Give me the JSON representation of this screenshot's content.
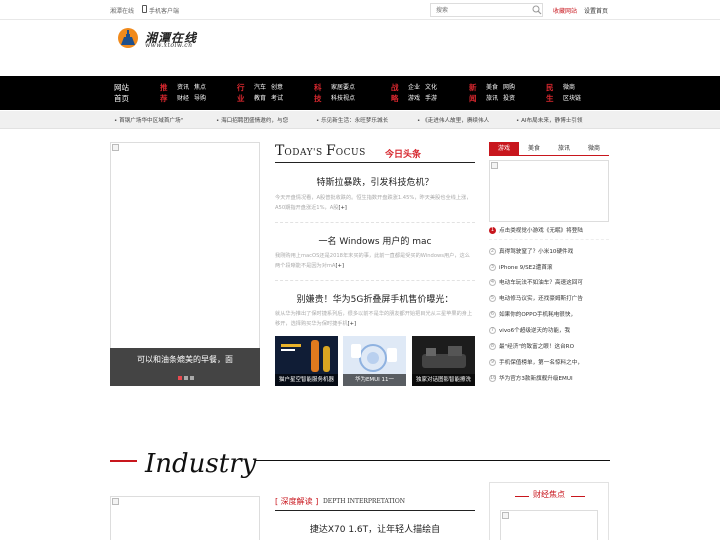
{
  "topbar": {
    "site_name": "湘潭在线",
    "mobile_client": "手机客户端",
    "search_placeholder": "搜索",
    "favorite": "收藏网站",
    "set_home": "设置首页"
  },
  "logo": {
    "title": "湘潭在线",
    "url": "www.xtolw.cn"
  },
  "nav": {
    "home": "网站首页",
    "groups": [
      {
        "cat": "推荐",
        "links": [
          "资讯",
          "焦点",
          "财经",
          "导购"
        ]
      },
      {
        "cat": "行业",
        "links": [
          "汽车",
          "创意",
          "教育",
          "考试"
        ]
      },
      {
        "cat": "科技",
        "links": [
          "家居要点",
          "科技视点"
        ]
      },
      {
        "cat": "战略",
        "links": [
          "企业",
          "文化",
          "游戏",
          "手游"
        ]
      },
      {
        "cat": "新闻",
        "links": [
          "美食",
          "网购",
          "旅讯",
          "投资"
        ]
      },
      {
        "cat": "民生",
        "links": [
          "微商",
          "区块链"
        ]
      }
    ]
  },
  "ticker": [
    "首钢广场华中区域首广场\"",
    "海口招聘团盛情邀约，与您",
    "乐见新生活：永旺梦乐城长",
    "《走进伟人故里，赓续伟人",
    "AI布局未来，静博士引领"
  ],
  "slideshow": {
    "caption": "可以和油条媲美的早餐，面",
    "dots": [
      {
        "active": true
      },
      {
        "active": false
      },
      {
        "active": false
      }
    ]
  },
  "focus": {
    "title_t": "T",
    "title_rest": "ODAY'S ",
    "title_f": "F",
    "title_rest2": "OCUS",
    "title_cn": "今日头条",
    "articles": [
      {
        "title": "特斯拉暴跌，引发科技危机？",
        "body": "今天开盘情况看，A股普批收跌的。恒生指数开盘跌涨1.45%，昨天美股也全线上涨，A50期指开盘涨近1%，A股",
        "more": "[+]"
      },
      {
        "title": "一名 Windows 用户的 mac",
        "body": "我刚购用上macOS还是2018年末买的事，此前一直都是受买的Windows用户，这么两个段晰能不是因为对mA",
        "more": "[+]"
      },
      {
        "title": "别嫌贵！华为5G折叠屏手机售价曝光：",
        "body": "就从华为推出了保时捷系列后，很多以前不是华的朋友都开始把目光从三星苹果的身上移开，选择购买华为保时捷手机",
        "more": "[+]"
      }
    ],
    "thumbs": [
      "猫户星空智能服务机器",
      "华为EMUI 11一",
      "独家对话图影智能擦洗"
    ]
  },
  "right": {
    "tabs": [
      "游戏",
      "美食",
      "旅讯",
      "微商"
    ],
    "active_tab": 0,
    "rank": [
      {
        "n": "1",
        "text": "点击类视觉小游戏《无眠》将登陆"
      },
      {
        "n": "2",
        "text": "真得驾驶窒了？小米10硬件戏"
      },
      {
        "n": "3",
        "text": "iPhone 9/SE2遭首滚"
      },
      {
        "n": "4",
        "text": "电动车玩法不如油车？高速这回可"
      },
      {
        "n": "5",
        "text": "电动修马议实，还找豪姆斯打广告"
      },
      {
        "n": "6",
        "text": "如果你的OPPO手机耗电很快，"
      },
      {
        "n": "7",
        "text": "vivo6个超级逆天的功能，我"
      },
      {
        "n": "8",
        "text": "最\"经济\"的致富之眼！这台RO"
      },
      {
        "n": "9",
        "text": "手机保值榜单，第一名惊料之中，"
      },
      {
        "n": "10",
        "text": "华为官方3款新旗舰升级EMUI"
      }
    ]
  },
  "industry": {
    "title": "Industry",
    "deep_label": "[ 深度解读 ]",
    "deep_label_en": "DEPTH INTERPRETATION",
    "deep_title": "捷达X70 1.6T，让年轻人描绘自",
    "finance_title": "财经焦点"
  },
  "colors": {
    "accent": "#c8161d",
    "nav_bg": "#000000",
    "ticker_bg": "#f0f0f0"
  }
}
